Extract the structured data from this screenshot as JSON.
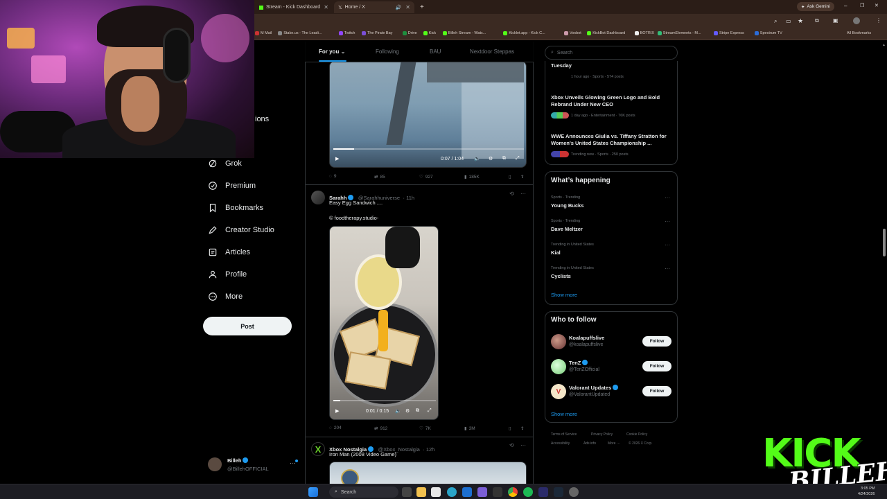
{
  "browser": {
    "tabs": [
      {
        "label": "Stream - Kick Dashboard"
      },
      {
        "label": "Home / X"
      }
    ],
    "ask_gemini": "Ask Gemini",
    "bookmarks": [
      "M Mail",
      "Stake.us - The Leadi...",
      "Twitch",
      "The Pirate Bay",
      "Drive",
      "Kick",
      "Billeh Stream - Watc...",
      "Kicklet.app - Kick C...",
      "Voxbot",
      "KickBot Dashboard",
      "BOTRIX",
      "StreamElements - M...",
      "Stripe Express",
      "Spectrum TV"
    ],
    "all_bookmarks": "All Bookmarks"
  },
  "nav": {
    "partial_label": "ions",
    "items": [
      {
        "label": "Grok",
        "icon": "grok-icon"
      },
      {
        "label": "Premium",
        "icon": "premium-icon"
      },
      {
        "label": "Bookmarks",
        "icon": "bookmark-icon"
      },
      {
        "label": "Creator Studio",
        "icon": "creator-studio-icon"
      },
      {
        "label": "Articles",
        "icon": "articles-icon"
      },
      {
        "label": "Profile",
        "icon": "profile-icon"
      },
      {
        "label": "More",
        "icon": "more-icon"
      }
    ],
    "post_button": "Post",
    "account": {
      "name": "Billeh",
      "handle": "@BillehOFFICIAL",
      "more": "···"
    }
  },
  "feed": {
    "tabs": [
      "For you",
      "Following",
      "BAU",
      "Nextdoor Steppas"
    ],
    "posts": [
      {
        "video_time": "0:07 / 1:04",
        "video_progress": 0.11,
        "stats": {
          "replies": "9",
          "reposts": "85",
          "likes": "927",
          "views": "185K"
        }
      },
      {
        "name": "Sarahh",
        "handle": "@Sarahhuniverse",
        "time": "· 11h",
        "text": "Easy Egg Sandwich ....",
        "text2": "© foodtherapy.studio-",
        "video_time": "0:01 / 0:15",
        "video_progress": 0.07,
        "stats": {
          "replies": "204",
          "reposts": "912",
          "likes": "7K",
          "views": "3M"
        }
      },
      {
        "name": "Xbox Nostalgia",
        "handle": "@Xbox_Nostalgia",
        "time": "· 12h",
        "text": "Iron Man (2008 Video Game)"
      }
    ]
  },
  "right": {
    "search_placeholder": "Search",
    "news": [
      {
        "title": "Tuesday",
        "meta": "1 hour ago · Sports · 574 posts"
      },
      {
        "title": "Xbox Unveils Glowing Green Logo and Bold Rebrand Under New CEO",
        "meta": "1 day ago · Entertainment · 76K posts"
      },
      {
        "title": "WWE Announces Giulia vs. Tiffany Stratton for Women's United States Championship ...",
        "meta": "Trending now · Sports · 250 posts"
      }
    ],
    "whats_happening": {
      "title": "What’s happening",
      "trends": [
        {
          "meta": "Sports · Trending",
          "name": "Young Bucks"
        },
        {
          "meta": "Sports · Trending",
          "name": "Dave Meltzer"
        },
        {
          "meta": "Trending in United States",
          "name": "Kial"
        },
        {
          "meta": "Trending in United States",
          "name": "Cyclists"
        }
      ],
      "show_more": "Show more"
    },
    "who_to_follow": {
      "title": "Who to follow",
      "users": [
        {
          "name": "Koalapuffslive",
          "handle": "@koalapuffslive",
          "verified": false
        },
        {
          "name": "TenZ",
          "handle": "@TenZOfficial",
          "verified": true
        },
        {
          "name": "Valorant Updates",
          "handle": "@ValorantUpdated",
          "verified": true
        }
      ],
      "follow_label": "Follow",
      "show_more": "Show more"
    },
    "footer": [
      "Terms of Service",
      "Privacy Policy",
      "Cookie Policy",
      "Accessibility",
      "Ads info",
      "More ···",
      "© 2026 X Corp."
    ]
  },
  "overlay": {
    "kick": "KICK",
    "billeh": "BILLEH"
  },
  "taskbar": {
    "search": "Search",
    "time": "3:05 PM",
    "date": "4/24/2026"
  },
  "colors": {
    "accent": "#1d9bf0",
    "kick_green": "#53fc18",
    "bg": "#000000"
  }
}
